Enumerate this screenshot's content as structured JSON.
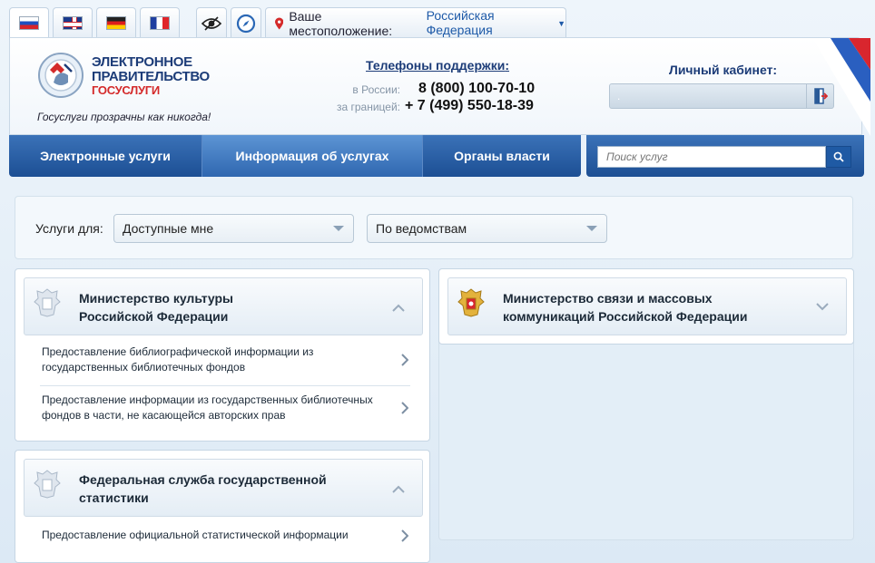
{
  "topbar": {
    "flags": [
      {
        "name": "russian",
        "active": true
      },
      {
        "name": "english",
        "active": false
      },
      {
        "name": "german",
        "active": false
      },
      {
        "name": "french",
        "active": false
      }
    ],
    "tools": [
      "accessibility-eye-icon",
      "compass-icon"
    ],
    "location_label": "Ваше местоположение:",
    "location_value": "Российская Федерация"
  },
  "header": {
    "logo_line1": "ЭЛЕКТРОННОЕ",
    "logo_line2": "ПРАВИТЕЛЬСТВО",
    "logo_line3": "ГОСУСЛУГИ",
    "slogan": "Госуслуги прозрачны как никогда!",
    "support_title": "Телефоны поддержки",
    "support_colon": ":",
    "phones": [
      {
        "label": "в России:",
        "number": "8 (800) 100-70-10"
      },
      {
        "label": "за границей:",
        "number": "+ 7 (499) 550-18-39"
      }
    ],
    "cabinet_title": "Личный кабинет:",
    "cabinet_name": "."
  },
  "nav": {
    "items": [
      {
        "label": "Электронные услуги",
        "active": false
      },
      {
        "label": "Информация об услугах",
        "active": true
      },
      {
        "label": "Органы власти",
        "active": false
      }
    ],
    "search_placeholder": "Поиск услуг"
  },
  "filters": {
    "label": "Услуги для:",
    "select1": "Доступные мне",
    "select2": "По ведомствам"
  },
  "left_column": [
    {
      "title_line1": "Министерство культуры",
      "title_line2": "Российской Федерации",
      "expanded": true,
      "services": [
        {
          "line1": "Предоставление библиографической информации из",
          "line2": "государственных библиотечных фондов"
        },
        {
          "line1": "Предоставление информации из государственных библиотечных",
          "line2": "фондов в части, не касающейся авторских прав"
        }
      ]
    },
    {
      "title_line1": "Федеральная служба государственной",
      "title_line2": "статистики",
      "expanded": true,
      "services": [
        {
          "line1": "Предоставление официальной статистической информации",
          "line2": ""
        }
      ]
    }
  ],
  "right_column": [
    {
      "title_line1": "Министерство связи и массовых",
      "title_line2": "коммуникаций Российской Федерации",
      "expanded": false
    }
  ],
  "colors": {
    "nav_blue": "#1c4f94",
    "accent_red": "#d42a2a",
    "title_blue": "#1c3c78",
    "link_blue": "#1e5aa8"
  }
}
